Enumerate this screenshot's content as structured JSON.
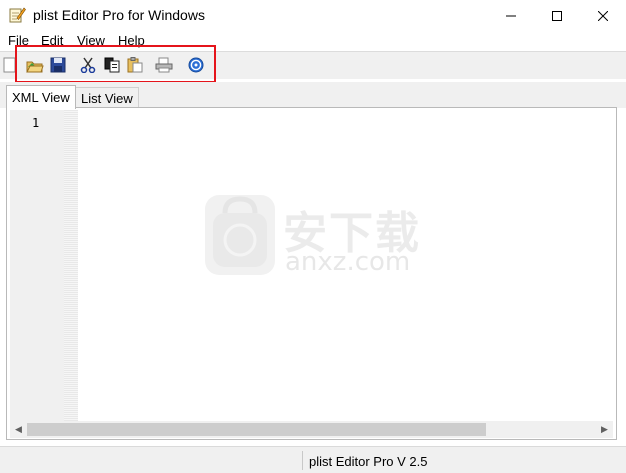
{
  "window": {
    "title": "plist Editor Pro for Windows",
    "icon": "notepad-pencil-icon"
  },
  "menu": [
    "File",
    "Edit",
    "View",
    "Help"
  ],
  "toolbar": {
    "buttons": [
      "new-icon",
      "open-icon",
      "save-icon",
      "cut-icon",
      "copy-icon",
      "paste-icon",
      "print-icon",
      "help-icon"
    ],
    "highlight_color": "#e5141b"
  },
  "tabs": {
    "xml": "XML View",
    "list": "List View",
    "active": "XML View"
  },
  "editor": {
    "line_number": "1"
  },
  "status": {
    "text": "plist Editor Pro V 2.5"
  },
  "watermark": {
    "cn": "安下载",
    "en": "anxz.com"
  }
}
